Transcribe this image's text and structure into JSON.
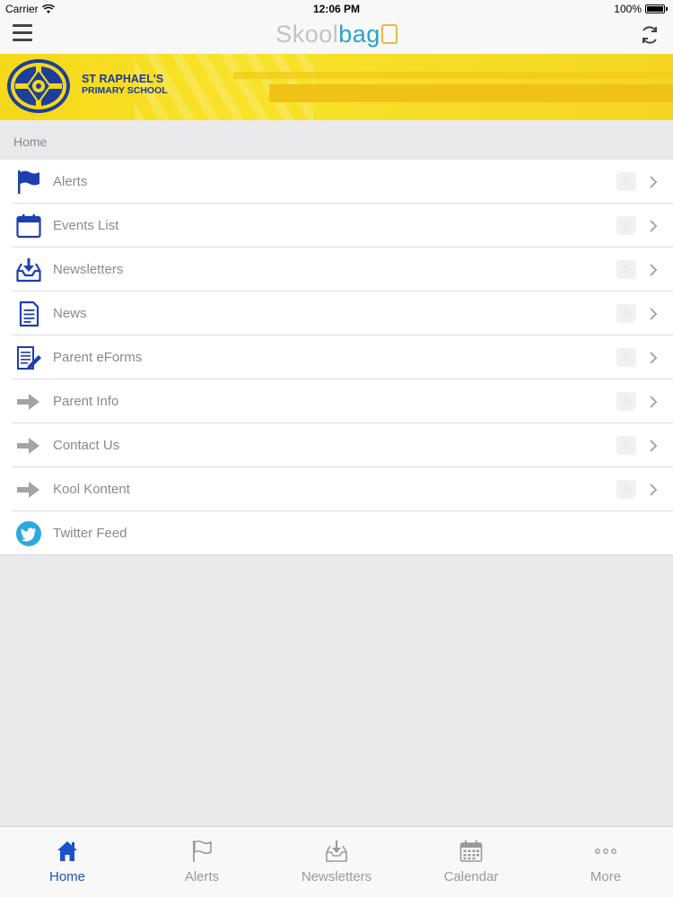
{
  "status_bar": {
    "carrier": "Carrier",
    "time": "12:06 PM",
    "battery": "100%"
  },
  "nav_bar": {
    "logo_part1": "Skool",
    "logo_part2": "bag"
  },
  "banner": {
    "school_name_line1": "ST RAPHAEL'S",
    "school_name_line2": "PRIMARY SCHOOL"
  },
  "breadcrumb": "Home",
  "menu": {
    "items": [
      {
        "label": "Alerts",
        "icon": "flag-icon",
        "badge": "0"
      },
      {
        "label": "Events List",
        "icon": "calendar-icon",
        "badge": "0"
      },
      {
        "label": "Newsletters",
        "icon": "download-tray-icon",
        "badge": "0"
      },
      {
        "label": "News",
        "icon": "document-icon",
        "badge": "0"
      },
      {
        "label": "Parent eForms",
        "icon": "form-pencil-icon",
        "badge": "0"
      },
      {
        "label": "Parent Info",
        "icon": "arrow-right-icon",
        "badge": "0"
      },
      {
        "label": "Contact Us",
        "icon": "arrow-right-icon",
        "badge": "0"
      },
      {
        "label": "Kool Kontent",
        "icon": "arrow-right-icon",
        "badge": "0"
      },
      {
        "label": "Twitter Feed",
        "icon": "twitter-icon",
        "badge": ""
      }
    ]
  },
  "tab_bar": {
    "tabs": [
      {
        "label": "Home",
        "icon": "home-icon",
        "active": true
      },
      {
        "label": "Alerts",
        "icon": "flag-icon",
        "active": false
      },
      {
        "label": "Newsletters",
        "icon": "download-tray-icon",
        "active": false
      },
      {
        "label": "Calendar",
        "icon": "calendar-grid-icon",
        "active": false
      },
      {
        "label": "More",
        "icon": "more-dots-icon",
        "active": false
      }
    ]
  },
  "colors": {
    "accent_blue": "#1a52c9",
    "banner_yellow": "#f6d81a",
    "twitter_blue": "#2aa9e0",
    "inactive_gray": "#9a9a9a"
  }
}
